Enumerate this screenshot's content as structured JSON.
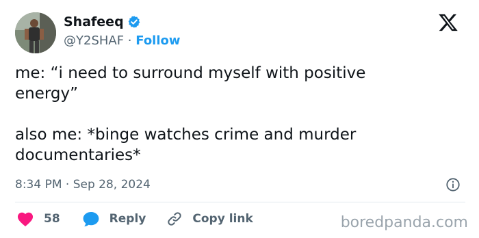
{
  "author": {
    "display_name": "Shafeeq",
    "handle": "@Y2SHAF",
    "separator": " · ",
    "follow_label": "Follow"
  },
  "tweet": {
    "text": "me: “i need to surround myself with positive\nenergy”\n\nalso me: *binge watches crime and murder\ndocumentaries*"
  },
  "meta": {
    "time": "8:34 PM",
    "separator": " · ",
    "date": "Sep 28, 2024"
  },
  "actions": {
    "like_count": "58",
    "reply_label": "Reply",
    "copy_link_label": "Copy link"
  },
  "watermark": "boredpanda.com",
  "colors": {
    "accent": "#1d9bf0",
    "like": "#f91880",
    "secondary_text": "#536471"
  },
  "icons": [
    "verified-badge-icon",
    "x-logo-icon",
    "info-icon",
    "heart-icon",
    "reply-bubble-icon",
    "link-icon"
  ]
}
